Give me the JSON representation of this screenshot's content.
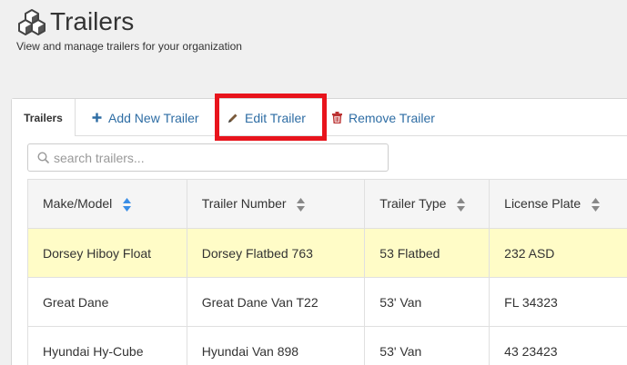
{
  "header": {
    "title": "Trailers",
    "subtitle": "View and manage trailers for your organization"
  },
  "toolbar": {
    "tab_label": "Trailers",
    "add_label": "Add New Trailer",
    "edit_label": "Edit Trailer",
    "remove_label": "Remove Trailer"
  },
  "search": {
    "placeholder": "search trailers..."
  },
  "table": {
    "columns": [
      "Make/Model",
      "Trailer Number",
      "Trailer Type",
      "License Plate"
    ],
    "rows": [
      {
        "make": "Dorsey Hiboy Float",
        "number": "Dorsey Flatbed 763",
        "type": "53 Flatbed",
        "plate": "232 ASD"
      },
      {
        "make": "Great Dane",
        "number": "Great Dane Van T22",
        "type": "53' Van",
        "plate": "FL 34323"
      },
      {
        "make": "Hyundai Hy-Cube",
        "number": "Hyundai Van 898",
        "type": "53' Van",
        "plate": "43 23423"
      }
    ]
  },
  "colors": {
    "accent": "#2e6da4",
    "highlight": "#e8141c",
    "selected_row": "#fffcc7"
  }
}
